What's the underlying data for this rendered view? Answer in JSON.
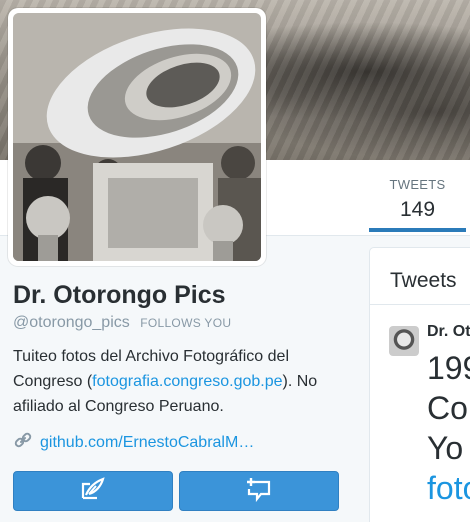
{
  "profile": {
    "name": "Dr. Otorongo Pics",
    "handle": "@otorongo_pics",
    "follows_you": "FOLLOWS YOU",
    "bio_before": "Tuiteo fotos del Archivo Fotográfico del Congreso (",
    "bio_link": "fotografia.congreso.gob.pe",
    "bio_after": "). No afiliado al Congreso Peruano.",
    "website": "github.com/ErnestoCabralM…"
  },
  "nav": {
    "stats": [
      {
        "label": "TWEETS",
        "value": "149"
      }
    ]
  },
  "buttons": {
    "icons": [
      "compose-tweet-icon",
      "direct-message-icon"
    ]
  },
  "tweets_panel": {
    "title": "Tweets",
    "first_tweet": {
      "author": "Dr. Ot",
      "lines": [
        "199",
        "Co",
        "Yo"
      ],
      "link_line": "foto"
    }
  },
  "colors": {
    "accent": "#3b94d9",
    "link": "#1b95e0",
    "text": "#292f33",
    "muted": "#8899a6"
  }
}
